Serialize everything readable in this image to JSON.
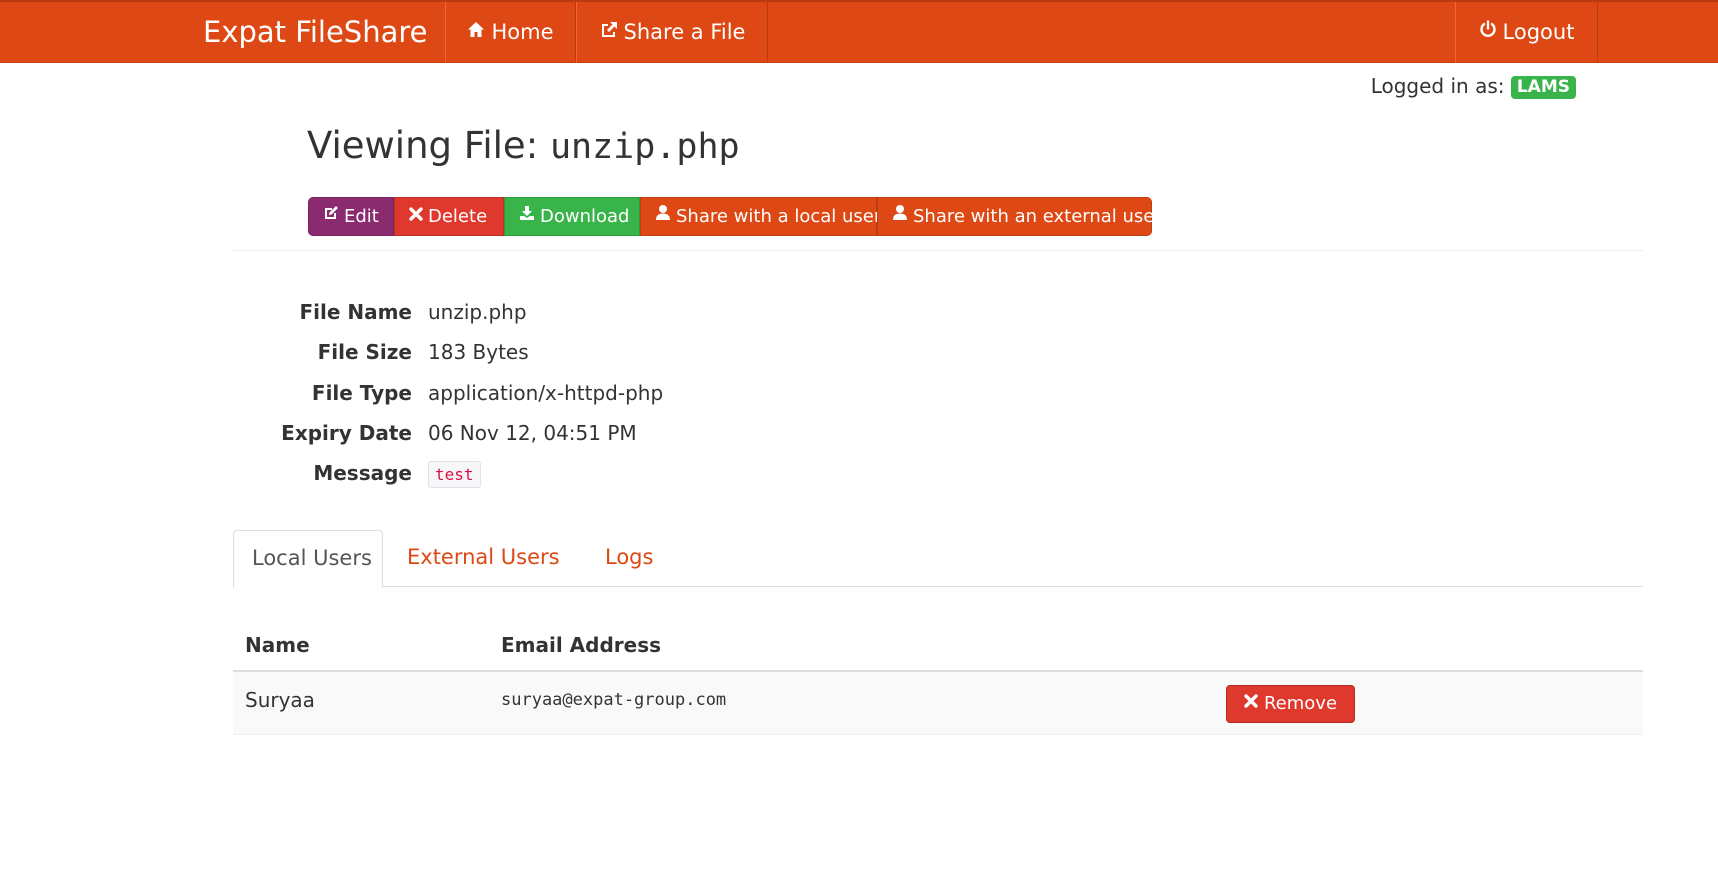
{
  "navbar": {
    "brand": "Expat FileShare",
    "home_label": "Home",
    "home_icon": "home-icon",
    "share_label": "Share a File",
    "share_icon": "share-icon",
    "logout_label": "Logout",
    "logout_icon": "power-icon",
    "color": "#dd4814"
  },
  "user": {
    "logged_in_label": "Logged in as:",
    "username": "LAMS"
  },
  "page": {
    "title_prefix": "Viewing File:",
    "title_file": "unzip.php"
  },
  "actions": {
    "edit": "Edit",
    "delete": "Delete",
    "download": "Download",
    "share_local": "Share with a local user",
    "share_external": "Share with an external user",
    "colors": {
      "edit": "#8a2b6f",
      "delete": "#df382c",
      "download": "#38b44a",
      "share": "#dd4814"
    }
  },
  "details": [
    {
      "label": "File Name",
      "value": "unzip.php"
    },
    {
      "label": "File Size",
      "value": "183 Bytes"
    },
    {
      "label": "File Type",
      "value": "application/x-httpd-php"
    },
    {
      "label": "Expiry Date",
      "value": "06 Nov 12, 04:51 PM"
    },
    {
      "label": "Message",
      "value": "test"
    }
  ],
  "tabs": [
    {
      "label": "Local Users",
      "active": true
    },
    {
      "label": "External Users",
      "active": false
    },
    {
      "label": "Logs",
      "active": false
    }
  ],
  "table": {
    "headers": [
      "Name",
      "Email Address"
    ],
    "rows": [
      {
        "name": "Suryaa",
        "email": "suryaa@expat-group.com",
        "action": "Remove"
      }
    ]
  }
}
